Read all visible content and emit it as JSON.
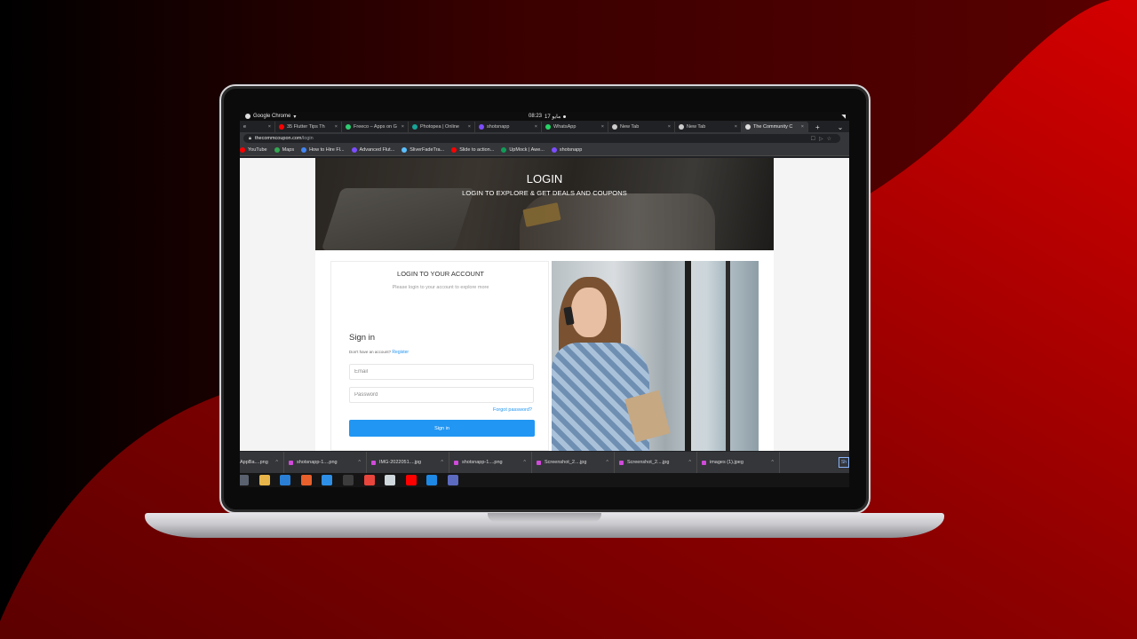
{
  "colors": {
    "accent": "#2196f3",
    "background_red": "#c00000"
  },
  "os_bar": {
    "app_name": "Google Chrome",
    "clock": "08:23",
    "date": "17 مايو"
  },
  "tabs": [
    {
      "label": "e",
      "icon": "partial-tab",
      "color": "#888888"
    },
    {
      "label": "35 Flutter Tips Th",
      "icon": "youtube-icon",
      "color": "#ff0000"
    },
    {
      "label": "Freeco – Apps on G",
      "icon": "play-store-icon",
      "color": "#2ecc71"
    },
    {
      "label": "Photopea | Online",
      "icon": "photopea-icon",
      "color": "#18a497"
    },
    {
      "label": "shotsnapp",
      "icon": "shotsnapp-icon",
      "color": "#7c4dff"
    },
    {
      "label": "WhatsApp",
      "icon": "whatsapp-icon",
      "color": "#25d366"
    },
    {
      "label": "New Tab",
      "icon": "chrome-icon",
      "color": "#cccccc"
    },
    {
      "label": "New Tab",
      "icon": "chrome-icon",
      "color": "#cccccc"
    },
    {
      "label": "The Community C",
      "icon": "globe-icon",
      "color": "#dddddd",
      "active": true
    }
  ],
  "address": {
    "host": "thecommcoupon.com",
    "path": "/login"
  },
  "bookmarks": [
    {
      "label": "YouTube",
      "color": "#ff0000"
    },
    {
      "label": "Maps",
      "color": "#34a853"
    },
    {
      "label": "How to Hire Fl...",
      "color": "#4285f4"
    },
    {
      "label": "Advanced Flut...",
      "color": "#7c4dff"
    },
    {
      "label": "SliverFadeTra...",
      "color": "#5bc0ff"
    },
    {
      "label": "Slide to action...",
      "color": "#ff0000"
    },
    {
      "label": "UpMock | Awe...",
      "color": "#0f9d58"
    },
    {
      "label": "shotsnapp",
      "color": "#7c4dff"
    }
  ],
  "hero": {
    "title": "LOGIN",
    "subtitle": "LOGIN TO EXPLORE & GET DEALS AND COUPONS"
  },
  "login": {
    "title": "LOGIN TO YOUR ACCOUNT",
    "subtitle": "Please login to your account to explore more",
    "signin_heading": "Sign in",
    "no_account": "Don't have an account?",
    "register": "Register",
    "email_placeholder": "Email",
    "password_placeholder": "Password",
    "forgot": "Forgot password?",
    "button": "Sign in"
  },
  "downloads": [
    "AppBa....png",
    "shotsnapp-1....png",
    "IMG-2022051....jpg",
    "shotsnapp-1....png",
    "Screenshot_2....jpg",
    "Screenshot_2....jpg",
    "images (1).jpeg"
  ],
  "dock_apps": [
    {
      "name": "files-icon",
      "color": "#5a6270"
    },
    {
      "name": "rhythmbox-icon",
      "color": "#e8b54a"
    },
    {
      "name": "writer-icon",
      "color": "#2a7fd4"
    },
    {
      "name": "software-icon",
      "color": "#e8602c"
    },
    {
      "name": "help-icon",
      "color": "#2e8fe6"
    },
    {
      "name": "terminal-icon",
      "color": "#3c3c3c"
    },
    {
      "name": "chrome-icon",
      "color": "#e8453c"
    },
    {
      "name": "settings-icon",
      "color": "#cfd8dc"
    },
    {
      "name": "youtube-icon",
      "color": "#ff0000"
    },
    {
      "name": "vscode-icon",
      "color": "#1e88e5"
    },
    {
      "name": "screenshot-icon",
      "color": "#5c6bc0"
    }
  ]
}
